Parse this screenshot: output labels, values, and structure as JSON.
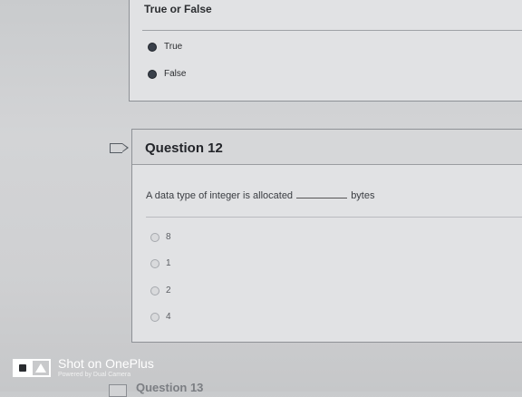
{
  "prev_question": {
    "title": "True or False",
    "options": [
      {
        "label": "True",
        "selected": false
      },
      {
        "label": "False",
        "selected": false
      }
    ]
  },
  "question12": {
    "title": "Question 12",
    "prompt_before": "A data type of integer is allocated",
    "prompt_after": "bytes",
    "choices": [
      "8",
      "1",
      "2",
      "4"
    ]
  },
  "next_question": {
    "title": "Question 13"
  },
  "watermark": {
    "title": "Shot on OnePlus",
    "subtitle": "Powered by Dual Camera"
  }
}
